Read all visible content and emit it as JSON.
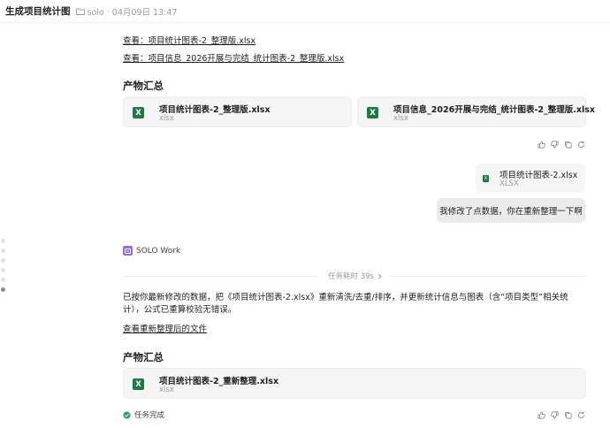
{
  "header": {
    "title": "生成项目统计图",
    "meta": "solo · 04月09日 13:47"
  },
  "links": {
    "view1": "查看：项目统计图表-2_整理版.xlsx",
    "view2": "查看：项目信息_2026开展与完结_统计图表-2_整理版.xlsx",
    "view_new": "查看重新整理后的文件"
  },
  "section1": {
    "title": "产物汇总",
    "files": [
      {
        "name": "项目统计图表-2_整理版.xlsx",
        "type": "xlsx"
      },
      {
        "name": "项目信息_2026开展与完结_统计图表-2_整理版.xlsx",
        "type": "xlsx"
      }
    ]
  },
  "user_message": {
    "file_name": "项目统计图表-2.xlsx",
    "file_type": "XLSX",
    "text": "我修改了点数据，你在重新整理一下啊"
  },
  "agent": {
    "name": "SOLO Work",
    "duration": "任务耗时 39s",
    "summary": "已按你最新修改的数据，把《项目统计图表-2.xlsx》重新清洗/去重/排序，并更新统计信息与图表（含“项目类型”相关统计），公式已重算校验无错误。"
  },
  "section2": {
    "title": "产物汇总",
    "files": [
      {
        "name": "项目统计图表-2_重新整理.xlsx",
        "type": "xlsx"
      }
    ]
  },
  "status": {
    "done": "任务完成"
  },
  "icons": {
    "file_badge": "X",
    "folder": "folder-icon",
    "thumb_up": "thumb-up-icon",
    "thumb_down": "thumb-down-icon",
    "copy": "copy-icon",
    "regenerate": "refresh-icon",
    "check": "check-circle-icon"
  },
  "colors": {
    "excel_green": "#1d7a45",
    "agent_purple": "#8e6cf0",
    "success_green": "#2fa35a"
  }
}
